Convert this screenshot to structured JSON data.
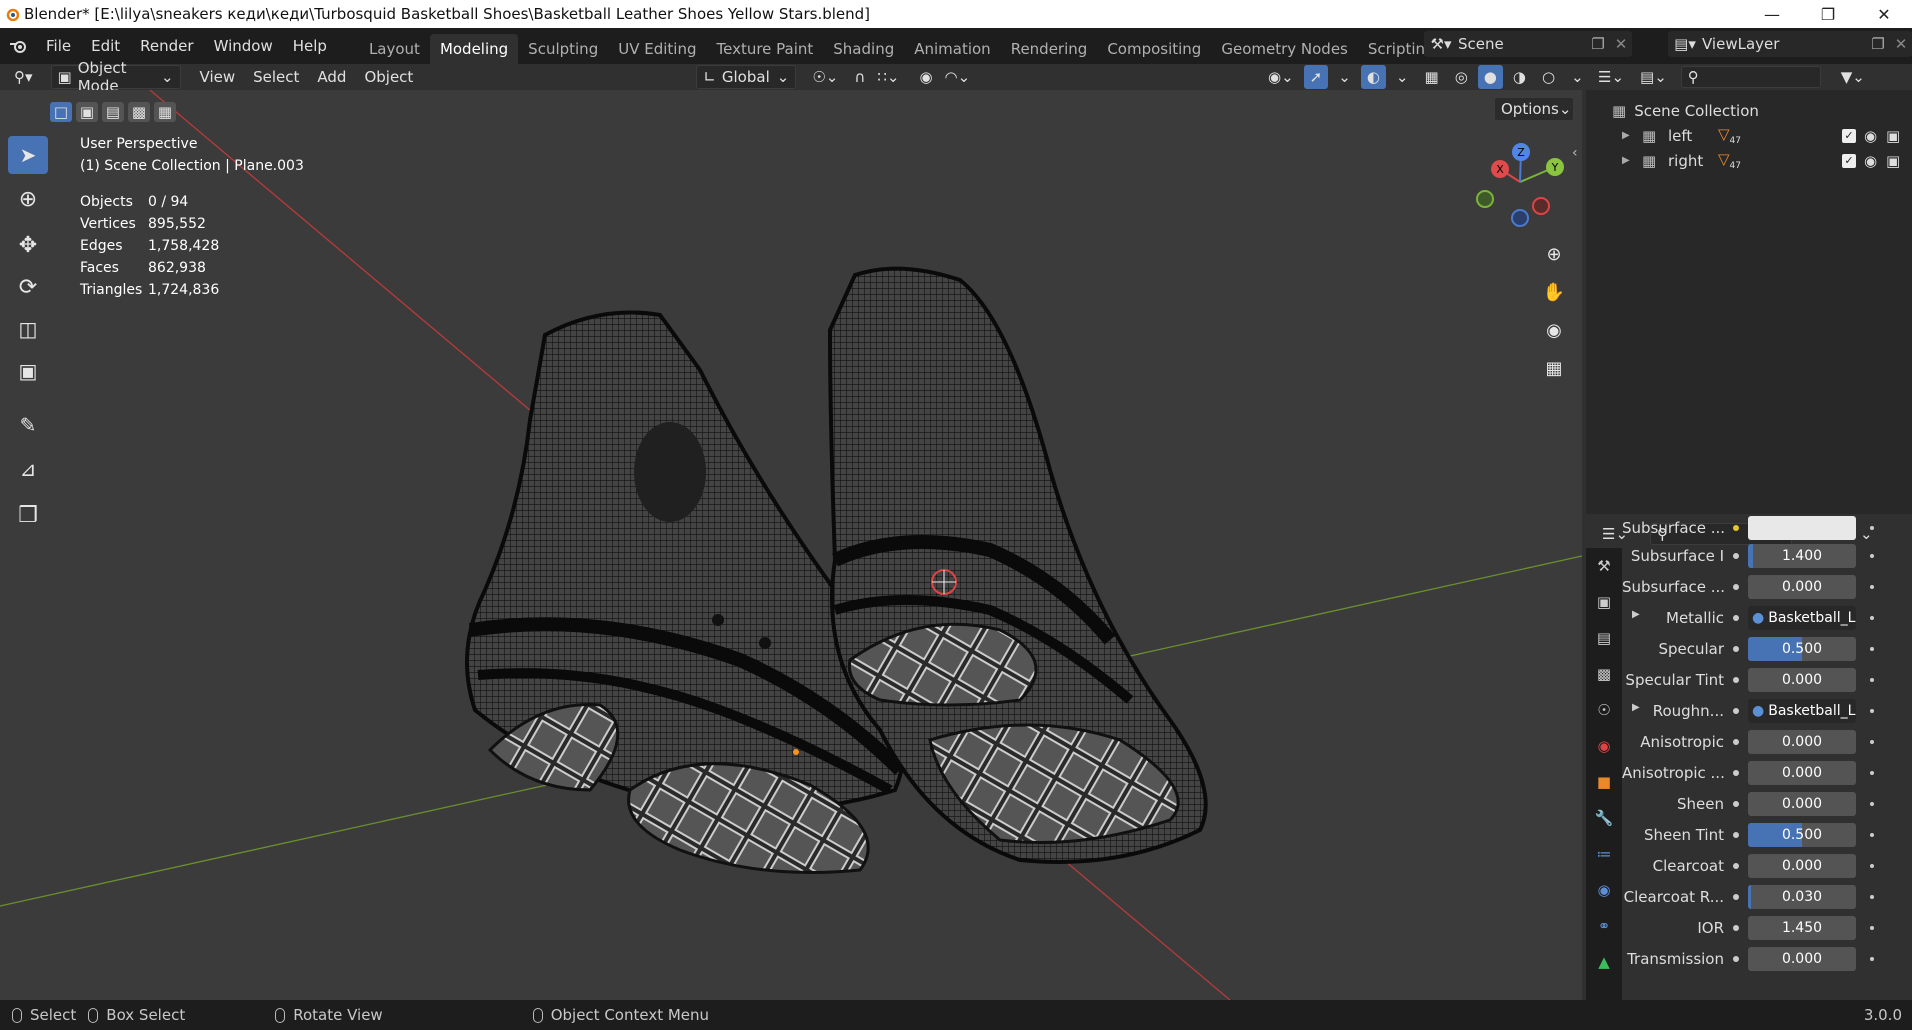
{
  "titlebar": {
    "title": "Blender* [E:\\lilya\\sneakers кеди\\кеди\\Turbosquid Basketball Shoes\\Basketball Leather Shoes Yellow Stars.blend]"
  },
  "menu": [
    "File",
    "Edit",
    "Render",
    "Window",
    "Help"
  ],
  "workspaces": [
    "Layout",
    "Modeling",
    "Sculpting",
    "UV Editing",
    "Texture Paint",
    "Shading",
    "Animation",
    "Rendering",
    "Compositing",
    "Geometry Nodes",
    "Scripting"
  ],
  "active_workspace": "Modeling",
  "scene": {
    "name": "Scene",
    "view_layer": "ViewLayer"
  },
  "viewport_header": {
    "mode": "Object Mode",
    "menus": [
      "View",
      "Select",
      "Add",
      "Object"
    ],
    "orientation": "Global",
    "options": "Options"
  },
  "overlay": {
    "perspective": "User Perspective",
    "collection": "(1) Scene Collection | Plane.003"
  },
  "stats": [
    {
      "label": "Objects",
      "value": "0 / 94"
    },
    {
      "label": "Vertices",
      "value": "895,552"
    },
    {
      "label": "Edges",
      "value": "1,758,428"
    },
    {
      "label": "Faces",
      "value": "862,938"
    },
    {
      "label": "Triangles",
      "value": "1,724,836"
    }
  ],
  "gizmo": {
    "x": "X",
    "y": "Y",
    "z": "Z"
  },
  "outliner": {
    "root": "Scene Collection",
    "items": [
      {
        "name": "left",
        "count": "47"
      },
      {
        "name": "right",
        "count": "47"
      }
    ]
  },
  "properties": [
    {
      "label": "Subsurface ...",
      "value": "",
      "fill": 1.0,
      "dot": "yellow",
      "kind": "color"
    },
    {
      "label": "Subsurface I",
      "value": "1.400",
      "fill": 0.05,
      "kind": "num"
    },
    {
      "label": "Subsurface ...",
      "value": "0.000",
      "fill": 0,
      "kind": "num"
    },
    {
      "label": "Metallic",
      "value": "Basketball_Lea...",
      "kind": "link",
      "expand": true
    },
    {
      "label": "Specular",
      "value": "0.500",
      "fill": 0.5,
      "kind": "num"
    },
    {
      "label": "Specular Tint",
      "value": "0.000",
      "fill": 0,
      "kind": "num"
    },
    {
      "label": "Roughn...",
      "value": "Basketball_Lea...",
      "kind": "link",
      "expand": true
    },
    {
      "label": "Anisotropic",
      "value": "0.000",
      "fill": 0,
      "kind": "num"
    },
    {
      "label": "Anisotropic ...",
      "value": "0.000",
      "fill": 0,
      "kind": "num"
    },
    {
      "label": "Sheen",
      "value": "0.000",
      "fill": 0,
      "kind": "num"
    },
    {
      "label": "Sheen Tint",
      "value": "0.500",
      "fill": 0.5,
      "kind": "num"
    },
    {
      "label": "Clearcoat",
      "value": "0.000",
      "fill": 0,
      "kind": "num"
    },
    {
      "label": "Clearcoat R...",
      "value": "0.030",
      "fill": 0.03,
      "kind": "num"
    },
    {
      "label": "IOR",
      "value": "1.450",
      "fill": 0,
      "kind": "num"
    },
    {
      "label": "Transmission",
      "value": "0.000",
      "fill": 0,
      "kind": "num"
    }
  ],
  "statusbar": {
    "select": "Select",
    "box_select": "Box Select",
    "rotate": "Rotate View",
    "context": "Object Context Menu",
    "version": "3.0.0"
  },
  "colors": {
    "accent": "#4772b3",
    "header": "#1d1d1d",
    "viewport": "#3b3b3b",
    "x_axis": "#c0392b",
    "y_axis": "#6a9a2a"
  }
}
